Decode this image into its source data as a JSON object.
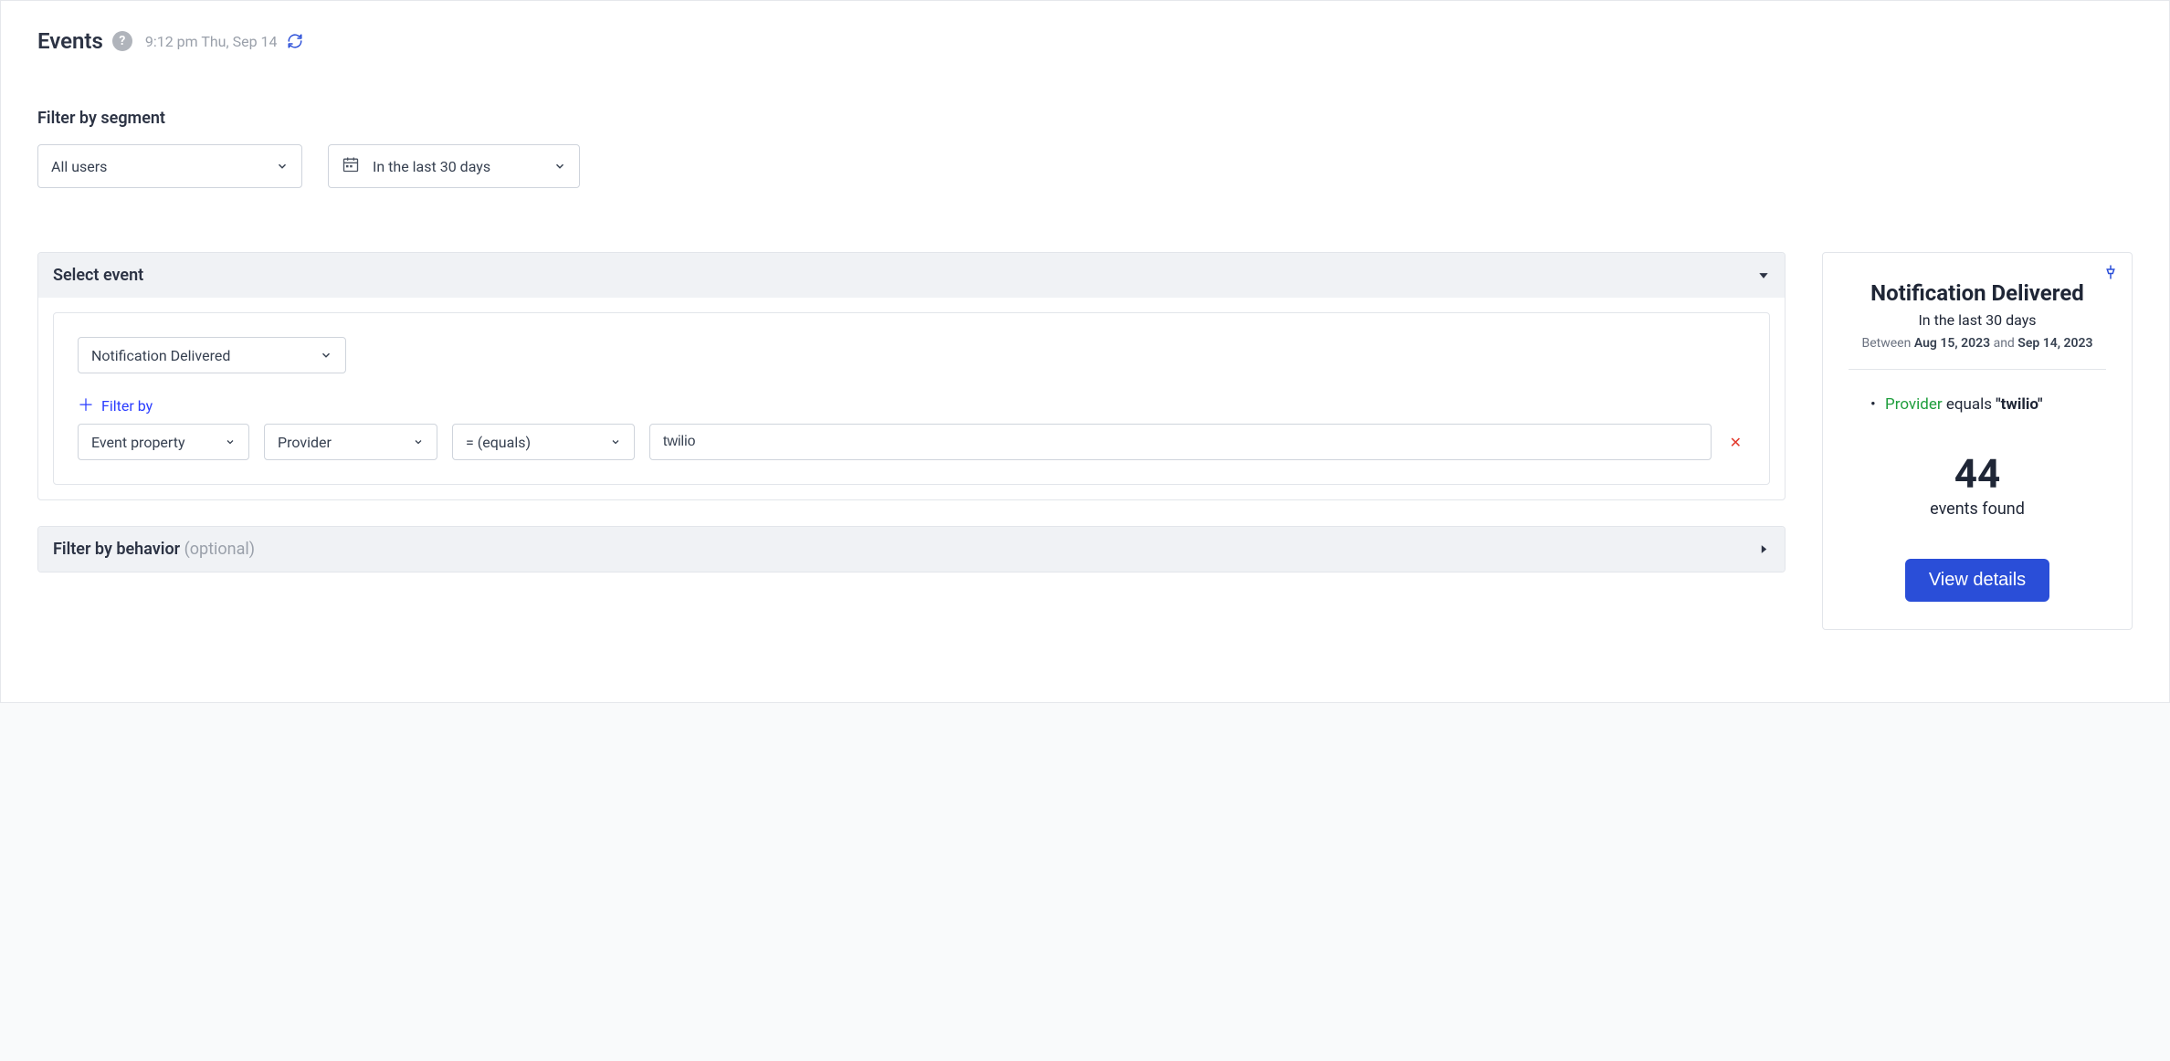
{
  "header": {
    "title": "Events",
    "help": "?",
    "timestamp": "9:12 pm Thu, Sep 14"
  },
  "segment": {
    "label": "Filter by segment",
    "users_select": "All users",
    "date_select": "In the last 30 days"
  },
  "event_panel": {
    "title": "Select event",
    "event_select": "Notification Delivered",
    "filter_by_label": "Filter by",
    "prop_select": "Event property",
    "field_select": "Provider",
    "operator_select": "=  (equals)",
    "value_input": "twilio"
  },
  "behavior_panel": {
    "title": "Filter by behavior",
    "optional": "(optional)"
  },
  "results": {
    "title": "Notification Delivered",
    "period": "In the last 30 days",
    "between_prefix": "Between ",
    "start_date": "Aug 15, 2023",
    "and_word": " and ",
    "end_date": "Sep 14, 2023",
    "filter_property": "Provider",
    "filter_operator": " equals ",
    "filter_value": "\"twilio\"",
    "count": "44",
    "found_label": "events found",
    "button": "View details"
  }
}
